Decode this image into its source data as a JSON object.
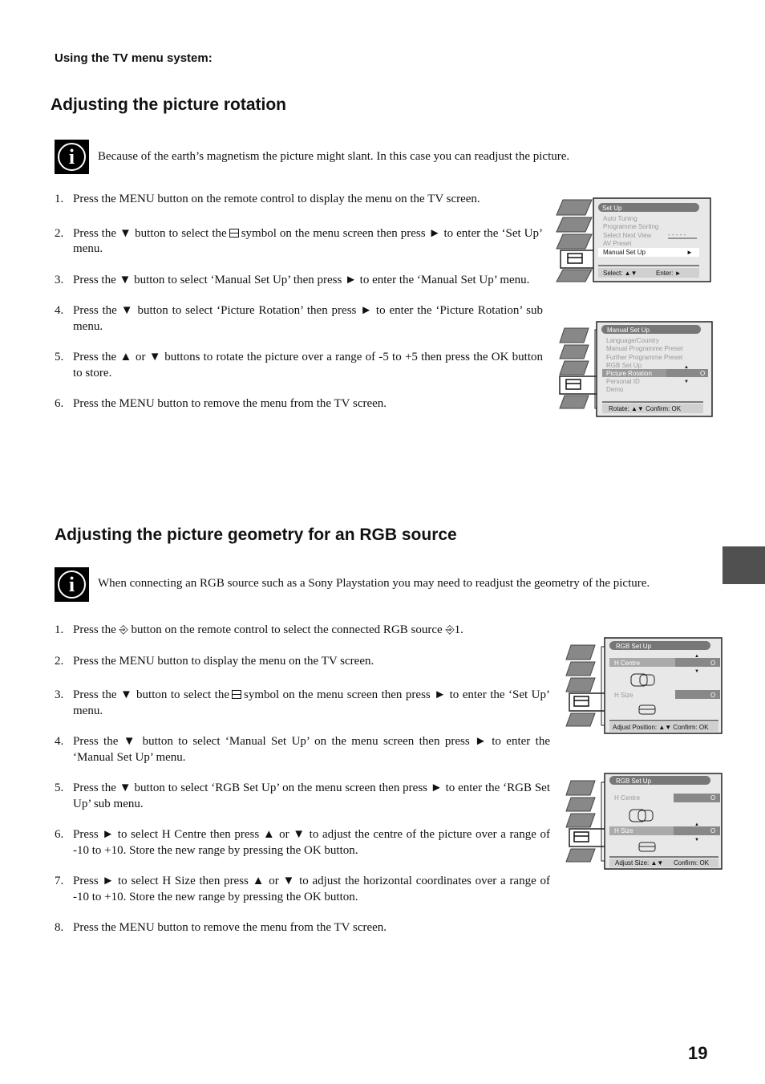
{
  "running_header": "Using the TV menu system:",
  "section1": {
    "title": "Adjusting the picture rotation",
    "note": "Because of the earth’s magnetism the picture might slant. In this case you can readjust the picture.",
    "steps": [
      {
        "num": "1.",
        "text": "Press the MENU button on the remote control to display the menu on the TV screen."
      },
      {
        "num": "2.",
        "pre": "Press the ▼ button to select the",
        "post": "symbol on the menu screen then press ► to enter the ‘Set Up’ menu."
      },
      {
        "num": "3.",
        "text": "Press the ▼ button to select ‘Manual Set Up’ then press ► to enter the ‘Manual Set Up’ menu."
      },
      {
        "num": "4.",
        "text": "Press the ▼ button to select ‘Picture Rotation’ then press ► to enter the ‘Picture Rotation’ sub menu."
      },
      {
        "num": "5.",
        "text": "Press the ▲ or ▼ buttons to rotate the picture over a range of -5 to +5 then press the OK button to store."
      },
      {
        "num": "6.",
        "text": "Press the MENU button to remove the menu from the TV screen."
      }
    ],
    "screen1": {
      "title": "Set Up",
      "items": [
        "Auto Tuning",
        "Programme Sorting",
        "Select Next View",
        "AV Preset",
        "Manual Set Up"
      ],
      "next_view_value": "- - - - -",
      "selected_arrow": "►",
      "footer_left": "Select: ▲▼",
      "footer_right": "Enter: ►"
    },
    "screen2": {
      "title": "Manual Set Up",
      "items": [
        "Language/Country",
        "Manual Programme Preset",
        "Further Programme Preset",
        "RGB Set Up",
        "Picture Rotation",
        "Personal ID",
        "Demo"
      ],
      "value": "O",
      "footer": "Rotate: ▲▼ Confirm: OK"
    }
  },
  "section2": {
    "title": "Adjusting the picture geometry for an RGB source",
    "note": "When connecting an RGB source such as a Sony Playstation you may need to readjust the geometry of the picture.",
    "steps": [
      {
        "num": "1.",
        "pre": "Press the",
        "mid": "button on the remote control to select the connected RGB source",
        "post": "1."
      },
      {
        "num": "2.",
        "text": "Press the MENU button to display the menu on the TV screen."
      },
      {
        "num": "3.",
        "pre": "Press the ▼ button to select the",
        "post": "symbol on the menu screen then press ► to enter the ‘Set Up’ menu."
      },
      {
        "num": "4.",
        "text": "Press the ▼ button to select ‘Manual Set Up’ on the menu screen then press ► to enter the ‘Manual Set Up’ menu."
      },
      {
        "num": "5.",
        "text": "Press the ▼ button to select ‘RGB Set Up’ on the menu screen then press ► to enter the ‘RGB Set Up’ sub menu."
      },
      {
        "num": "6.",
        "text": "Press ► to select H Centre then press ▲ or ▼ to adjust the centre of the picture over a range of -10 to +10. Store the new range by pressing the OK button."
      },
      {
        "num": "7.",
        "text": "Press ► to select H Size then press ▲ or ▼ to adjust the horizontal coordinates over a range of -10 to +10. Store the new range by pressing the OK button."
      },
      {
        "num": "8.",
        "text": "Press the MENU button to remove the menu from the TV screen."
      }
    ],
    "screen3": {
      "title": "RGB Set Up",
      "h_centre": "H Centre",
      "h_size": "H Size",
      "value": "O",
      "footer": "Adjust Position: ▲▼ Confirm: OK"
    },
    "screen4": {
      "title": "RGB Set Up",
      "h_centre": "H Centre",
      "h_size": "H Size",
      "value": "O",
      "footer_left": "Adjust Size: ▲▼",
      "footer_right": "Confirm: OK"
    }
  },
  "page_number": "19"
}
